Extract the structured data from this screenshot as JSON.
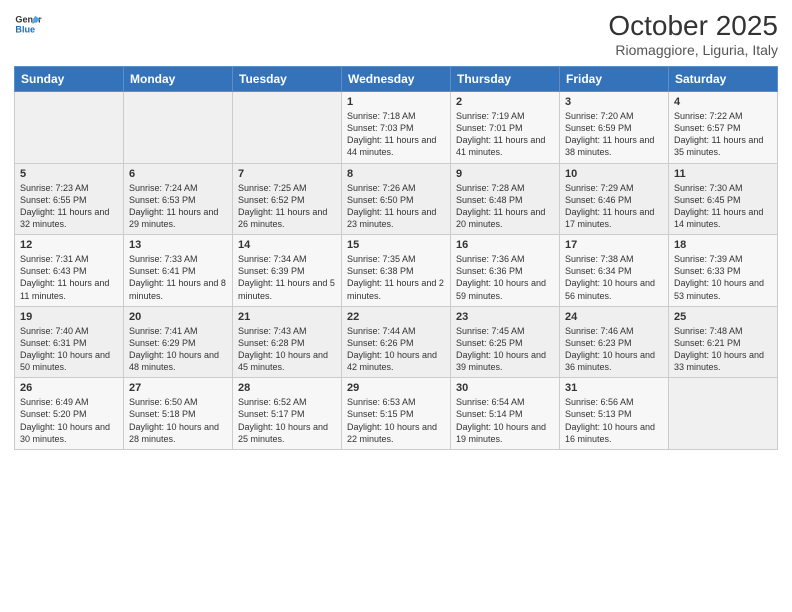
{
  "header": {
    "logo_general": "General",
    "logo_blue": "Blue",
    "month_title": "October 2025",
    "location": "Riomaggiore, Liguria, Italy"
  },
  "days_of_week": [
    "Sunday",
    "Monday",
    "Tuesday",
    "Wednesday",
    "Thursday",
    "Friday",
    "Saturday"
  ],
  "weeks": [
    [
      {
        "day": "",
        "sunrise": "",
        "sunset": "",
        "daylight": ""
      },
      {
        "day": "",
        "sunrise": "",
        "sunset": "",
        "daylight": ""
      },
      {
        "day": "",
        "sunrise": "",
        "sunset": "",
        "daylight": ""
      },
      {
        "day": "1",
        "sunrise": "Sunrise: 7:18 AM",
        "sunset": "Sunset: 7:03 PM",
        "daylight": "Daylight: 11 hours and 44 minutes."
      },
      {
        "day": "2",
        "sunrise": "Sunrise: 7:19 AM",
        "sunset": "Sunset: 7:01 PM",
        "daylight": "Daylight: 11 hours and 41 minutes."
      },
      {
        "day": "3",
        "sunrise": "Sunrise: 7:20 AM",
        "sunset": "Sunset: 6:59 PM",
        "daylight": "Daylight: 11 hours and 38 minutes."
      },
      {
        "day": "4",
        "sunrise": "Sunrise: 7:22 AM",
        "sunset": "Sunset: 6:57 PM",
        "daylight": "Daylight: 11 hours and 35 minutes."
      }
    ],
    [
      {
        "day": "5",
        "sunrise": "Sunrise: 7:23 AM",
        "sunset": "Sunset: 6:55 PM",
        "daylight": "Daylight: 11 hours and 32 minutes."
      },
      {
        "day": "6",
        "sunrise": "Sunrise: 7:24 AM",
        "sunset": "Sunset: 6:53 PM",
        "daylight": "Daylight: 11 hours and 29 minutes."
      },
      {
        "day": "7",
        "sunrise": "Sunrise: 7:25 AM",
        "sunset": "Sunset: 6:52 PM",
        "daylight": "Daylight: 11 hours and 26 minutes."
      },
      {
        "day": "8",
        "sunrise": "Sunrise: 7:26 AM",
        "sunset": "Sunset: 6:50 PM",
        "daylight": "Daylight: 11 hours and 23 minutes."
      },
      {
        "day": "9",
        "sunrise": "Sunrise: 7:28 AM",
        "sunset": "Sunset: 6:48 PM",
        "daylight": "Daylight: 11 hours and 20 minutes."
      },
      {
        "day": "10",
        "sunrise": "Sunrise: 7:29 AM",
        "sunset": "Sunset: 6:46 PM",
        "daylight": "Daylight: 11 hours and 17 minutes."
      },
      {
        "day": "11",
        "sunrise": "Sunrise: 7:30 AM",
        "sunset": "Sunset: 6:45 PM",
        "daylight": "Daylight: 11 hours and 14 minutes."
      }
    ],
    [
      {
        "day": "12",
        "sunrise": "Sunrise: 7:31 AM",
        "sunset": "Sunset: 6:43 PM",
        "daylight": "Daylight: 11 hours and 11 minutes."
      },
      {
        "day": "13",
        "sunrise": "Sunrise: 7:33 AM",
        "sunset": "Sunset: 6:41 PM",
        "daylight": "Daylight: 11 hours and 8 minutes."
      },
      {
        "day": "14",
        "sunrise": "Sunrise: 7:34 AM",
        "sunset": "Sunset: 6:39 PM",
        "daylight": "Daylight: 11 hours and 5 minutes."
      },
      {
        "day": "15",
        "sunrise": "Sunrise: 7:35 AM",
        "sunset": "Sunset: 6:38 PM",
        "daylight": "Daylight: 11 hours and 2 minutes."
      },
      {
        "day": "16",
        "sunrise": "Sunrise: 7:36 AM",
        "sunset": "Sunset: 6:36 PM",
        "daylight": "Daylight: 10 hours and 59 minutes."
      },
      {
        "day": "17",
        "sunrise": "Sunrise: 7:38 AM",
        "sunset": "Sunset: 6:34 PM",
        "daylight": "Daylight: 10 hours and 56 minutes."
      },
      {
        "day": "18",
        "sunrise": "Sunrise: 7:39 AM",
        "sunset": "Sunset: 6:33 PM",
        "daylight": "Daylight: 10 hours and 53 minutes."
      }
    ],
    [
      {
        "day": "19",
        "sunrise": "Sunrise: 7:40 AM",
        "sunset": "Sunset: 6:31 PM",
        "daylight": "Daylight: 10 hours and 50 minutes."
      },
      {
        "day": "20",
        "sunrise": "Sunrise: 7:41 AM",
        "sunset": "Sunset: 6:29 PM",
        "daylight": "Daylight: 10 hours and 48 minutes."
      },
      {
        "day": "21",
        "sunrise": "Sunrise: 7:43 AM",
        "sunset": "Sunset: 6:28 PM",
        "daylight": "Daylight: 10 hours and 45 minutes."
      },
      {
        "day": "22",
        "sunrise": "Sunrise: 7:44 AM",
        "sunset": "Sunset: 6:26 PM",
        "daylight": "Daylight: 10 hours and 42 minutes."
      },
      {
        "day": "23",
        "sunrise": "Sunrise: 7:45 AM",
        "sunset": "Sunset: 6:25 PM",
        "daylight": "Daylight: 10 hours and 39 minutes."
      },
      {
        "day": "24",
        "sunrise": "Sunrise: 7:46 AM",
        "sunset": "Sunset: 6:23 PM",
        "daylight": "Daylight: 10 hours and 36 minutes."
      },
      {
        "day": "25",
        "sunrise": "Sunrise: 7:48 AM",
        "sunset": "Sunset: 6:21 PM",
        "daylight": "Daylight: 10 hours and 33 minutes."
      }
    ],
    [
      {
        "day": "26",
        "sunrise": "Sunrise: 6:49 AM",
        "sunset": "Sunset: 5:20 PM",
        "daylight": "Daylight: 10 hours and 30 minutes."
      },
      {
        "day": "27",
        "sunrise": "Sunrise: 6:50 AM",
        "sunset": "Sunset: 5:18 PM",
        "daylight": "Daylight: 10 hours and 28 minutes."
      },
      {
        "day": "28",
        "sunrise": "Sunrise: 6:52 AM",
        "sunset": "Sunset: 5:17 PM",
        "daylight": "Daylight: 10 hours and 25 minutes."
      },
      {
        "day": "29",
        "sunrise": "Sunrise: 6:53 AM",
        "sunset": "Sunset: 5:15 PM",
        "daylight": "Daylight: 10 hours and 22 minutes."
      },
      {
        "day": "30",
        "sunrise": "Sunrise: 6:54 AM",
        "sunset": "Sunset: 5:14 PM",
        "daylight": "Daylight: 10 hours and 19 minutes."
      },
      {
        "day": "31",
        "sunrise": "Sunrise: 6:56 AM",
        "sunset": "Sunset: 5:13 PM",
        "daylight": "Daylight: 10 hours and 16 minutes."
      },
      {
        "day": "",
        "sunrise": "",
        "sunset": "",
        "daylight": ""
      }
    ]
  ]
}
